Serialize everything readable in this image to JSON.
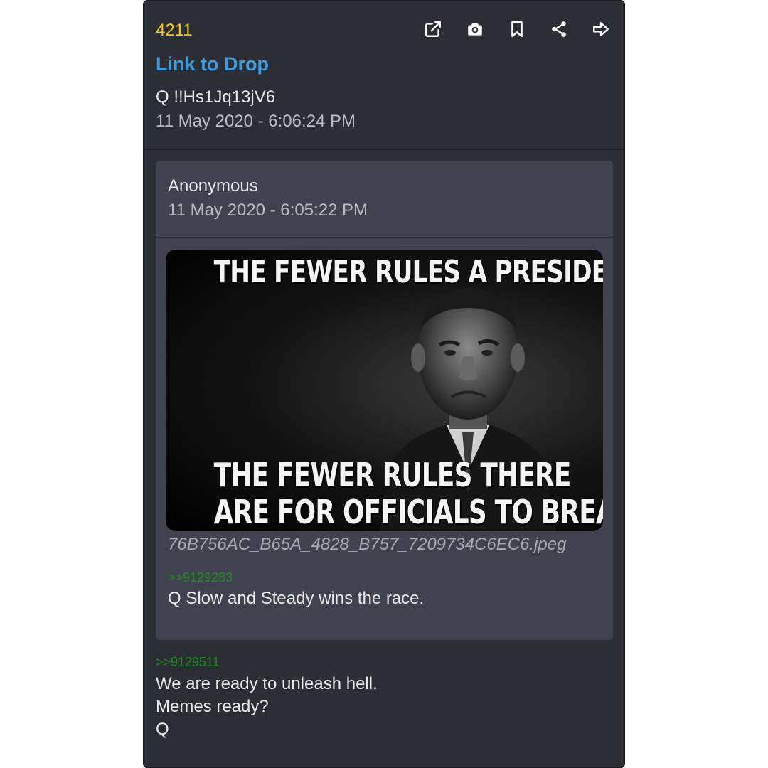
{
  "post": {
    "number": "4211",
    "link_label": "Link to Drop",
    "author": "Q  !!Hs1Jq13jV6",
    "timestamp": "11 May 2020 - 6:06:24 PM"
  },
  "toolbar": {
    "icons": [
      "open-external-icon",
      "camera-icon",
      "bookmark-icon",
      "share-icon",
      "forward-arrow-icon"
    ]
  },
  "quoted_post": {
    "author": "Anonymous",
    "timestamp": "11 May 2020 - 6:05:22 PM",
    "image": {
      "top_text": "THE FEWER RULES A PRESIDENT HAS,",
      "bottom_text_1": "THE FEWER RULES THERE",
      "bottom_text_2": "ARE FOR OFFICIALS TO BREAK."
    },
    "filename": "76B756AC_B65A_4828_B757_7209734C6EC6.jpeg",
    "reference": ">>9129283",
    "message": "Q Slow and Steady wins the race."
  },
  "message": {
    "reference": ">>9129511",
    "lines": [
      "We are ready to unleash hell.",
      "Memes ready?",
      "Q"
    ]
  },
  "colors": {
    "card_bg": "#2c2e36",
    "quote_bg": "#40434f",
    "drop_number": "#f5c518",
    "link": "#3d9be0",
    "reference_green": "#1f8b1f"
  }
}
